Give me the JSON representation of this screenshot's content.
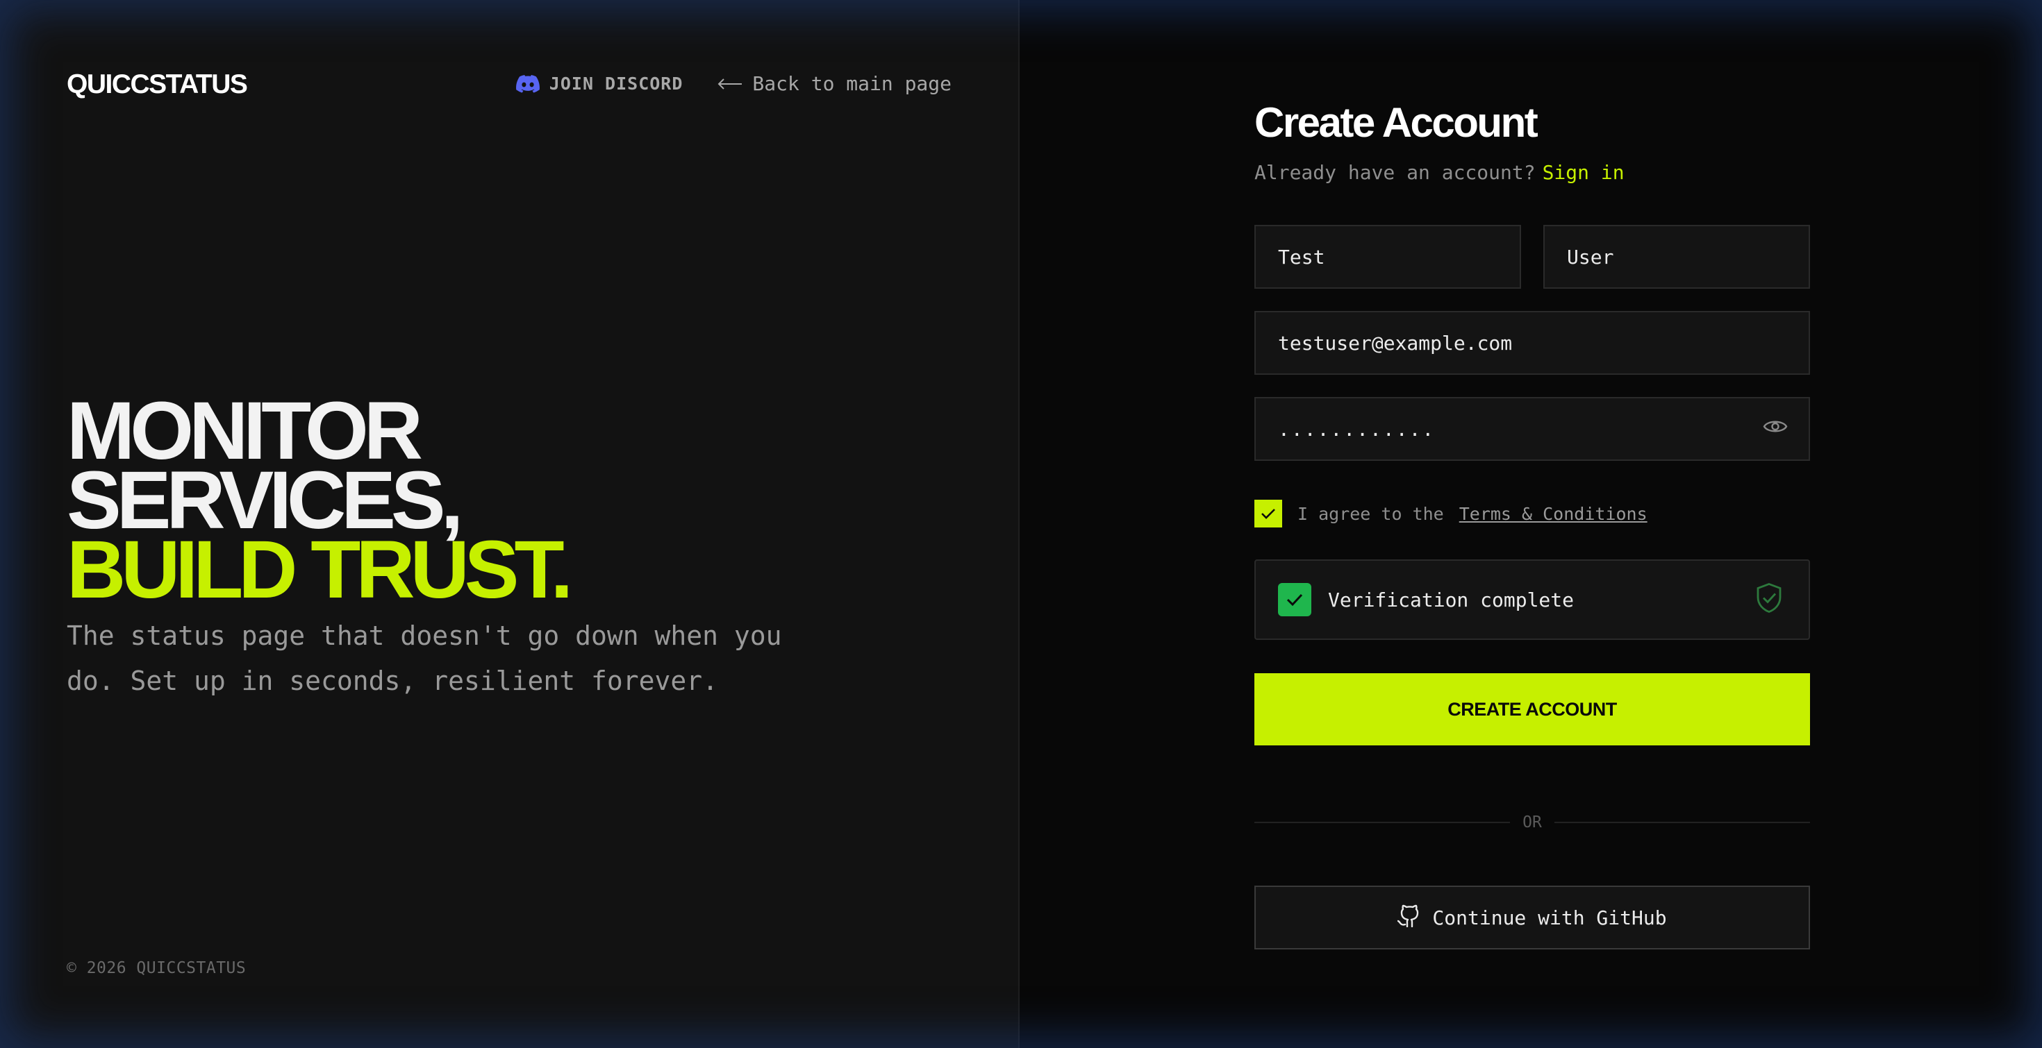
{
  "brand": "QUICCSTATUS",
  "nav": {
    "discord_label": "JOIN DISCORD",
    "back_label": "Back to main page"
  },
  "hero": {
    "line1": "MONITOR",
    "line2": "SERVICES,",
    "line3": "BUILD TRUST.",
    "tagline": "The status page that doesn't go down when you do. Set up in seconds, resilient forever."
  },
  "footer": {
    "copyright": "© 2026 QUICCSTATUS"
  },
  "form": {
    "title": "Create Account",
    "have_account_text": "Already have an account?",
    "signin_label": "Sign in",
    "first_name": "Test",
    "last_name": "User",
    "email": "testuser@example.com",
    "password_masked": "............",
    "terms_prefix": "I agree to the",
    "terms_link": "Terms & Conditions",
    "terms_checked": true,
    "verification_text": "Verification complete",
    "submit_label": "CREATE ACCOUNT",
    "divider_label": "OR",
    "github_label": "Continue with GitHub"
  },
  "colors": {
    "accent": "#c6f000",
    "verify_green": "#1fb64d",
    "discord": "#5865f2",
    "left_bg": "#121212",
    "right_bg": "#080808"
  },
  "icons": [
    "discord-icon",
    "arrow-left-icon",
    "eye-icon",
    "checkmark-icon",
    "shield-check-icon",
    "github-icon"
  ]
}
